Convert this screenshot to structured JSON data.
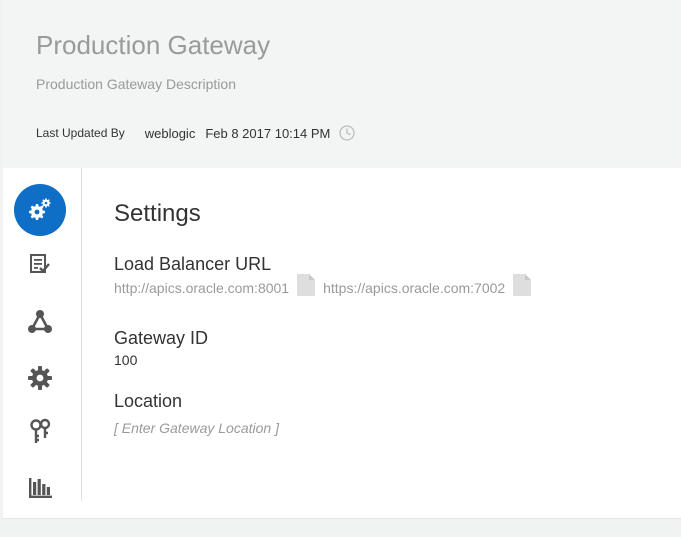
{
  "header": {
    "title": "Production Gateway",
    "description": "Production Gateway Description",
    "last_updated_label": "Last Updated By",
    "last_updated_user": "weblogic",
    "last_updated_time": "Feb 8 2017 10:14 PM"
  },
  "nav": {
    "items": [
      {
        "name": "settings",
        "icon": "gears-icon",
        "active": true
      },
      {
        "name": "checklist",
        "icon": "checklist-icon",
        "active": false
      },
      {
        "name": "nodes",
        "icon": "nodes-icon",
        "active": false
      },
      {
        "name": "gear",
        "icon": "gear-icon",
        "active": false
      },
      {
        "name": "keys",
        "icon": "keys-icon",
        "active": false
      },
      {
        "name": "analytics",
        "icon": "bar-chart-icon",
        "active": false
      }
    ]
  },
  "settings": {
    "title": "Settings",
    "load_balancer": {
      "label": "Load Balancer URL",
      "urls": [
        "http://apics.oracle.com:8001",
        "https://apics.oracle.com:7002"
      ]
    },
    "gateway_id": {
      "label": "Gateway ID",
      "value": "100"
    },
    "location": {
      "label": "Location",
      "placeholder": "[ Enter Gateway Location ]"
    }
  },
  "colors": {
    "accent": "#0f6fc6",
    "icon": "#555555",
    "muted_text": "#9a9a9a"
  }
}
